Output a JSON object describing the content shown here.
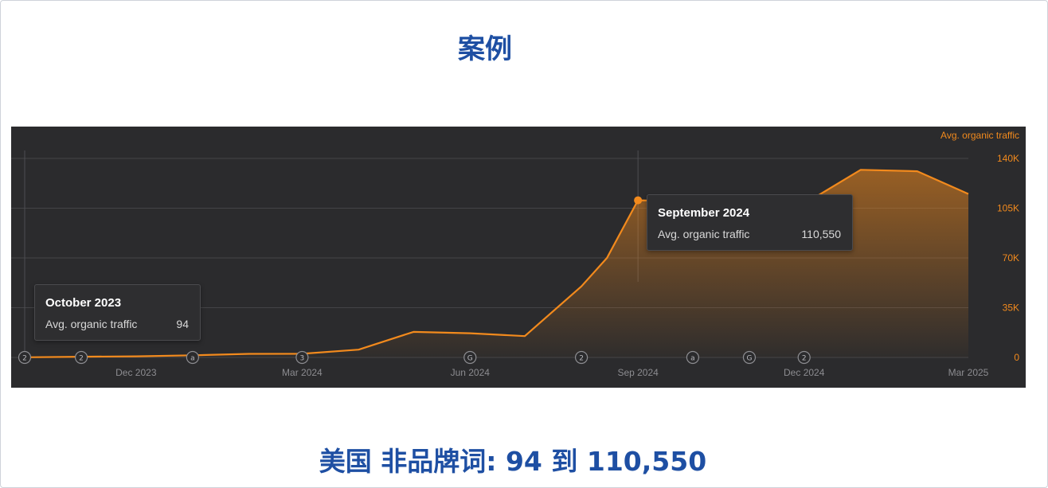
{
  "page": {
    "title": "案例",
    "subtitle": "美国 非品牌词: 94 到 110,550"
  },
  "colors": {
    "accent": "#f28a1d",
    "title_blue": "#1e4fa3",
    "chart_bg": "#2b2b2d"
  },
  "chart_data": {
    "type": "area",
    "y_axis_title": "Avg. organic traffic",
    "series": [
      {
        "name": "Avg. organic traffic",
        "points": [
          {
            "x": "2023-10",
            "y": 94
          },
          {
            "x": "2023-11",
            "y": 500
          },
          {
            "x": "2023-12",
            "y": 800
          },
          {
            "x": "2024-01",
            "y": 1500
          },
          {
            "x": "2024-02",
            "y": 2500
          },
          {
            "x": "2024-03",
            "y": 2600
          },
          {
            "x": "2024-04",
            "y": 5500
          },
          {
            "x": "2024-05",
            "y": 18000
          },
          {
            "x": "2024-06",
            "y": 17000
          },
          {
            "x": "2024-07",
            "y": 15000
          },
          {
            "x": "2024-08",
            "y": 50000
          },
          {
            "x": "2024-08-15",
            "y": 70000
          },
          {
            "x": "2024-09",
            "y": 110550
          },
          {
            "x": "2024-12",
            "y": 108000
          },
          {
            "x": "2025-01",
            "y": 132000
          },
          {
            "x": "2025-02",
            "y": 131000
          },
          {
            "x": "2025-03",
            "y": 115000
          }
        ]
      }
    ],
    "x_tick_labels": [
      "Dec 2023",
      "Mar 2024",
      "Jun 2024",
      "Sep 2024",
      "Dec 2024",
      "Mar 2025"
    ],
    "y_ticks": [
      0,
      35000,
      70000,
      105000,
      140000
    ],
    "y_tick_labels": [
      "0",
      "35K",
      "70K",
      "105K",
      "140K"
    ],
    "ylim": [
      0,
      140000
    ],
    "grid": true,
    "annotation_markers": [
      {
        "label": "2",
        "x": "2023-10"
      },
      {
        "label": "2",
        "x": "2023-11"
      },
      {
        "label": "a",
        "x": "2024-01"
      },
      {
        "label": "3",
        "x": "2024-03"
      },
      {
        "label": "G",
        "x": "2024-06"
      },
      {
        "label": "2",
        "x": "2024-08"
      },
      {
        "label": "a",
        "x": "2024-10"
      },
      {
        "label": "G",
        "x": "2024-11"
      },
      {
        "label": "2",
        "x": "2024-12"
      }
    ],
    "tooltips": [
      {
        "title": "October 2023",
        "label": "Avg. organic traffic",
        "value": "94"
      },
      {
        "title": "September 2024",
        "label": "Avg. organic traffic",
        "value": "110,550"
      }
    ]
  }
}
